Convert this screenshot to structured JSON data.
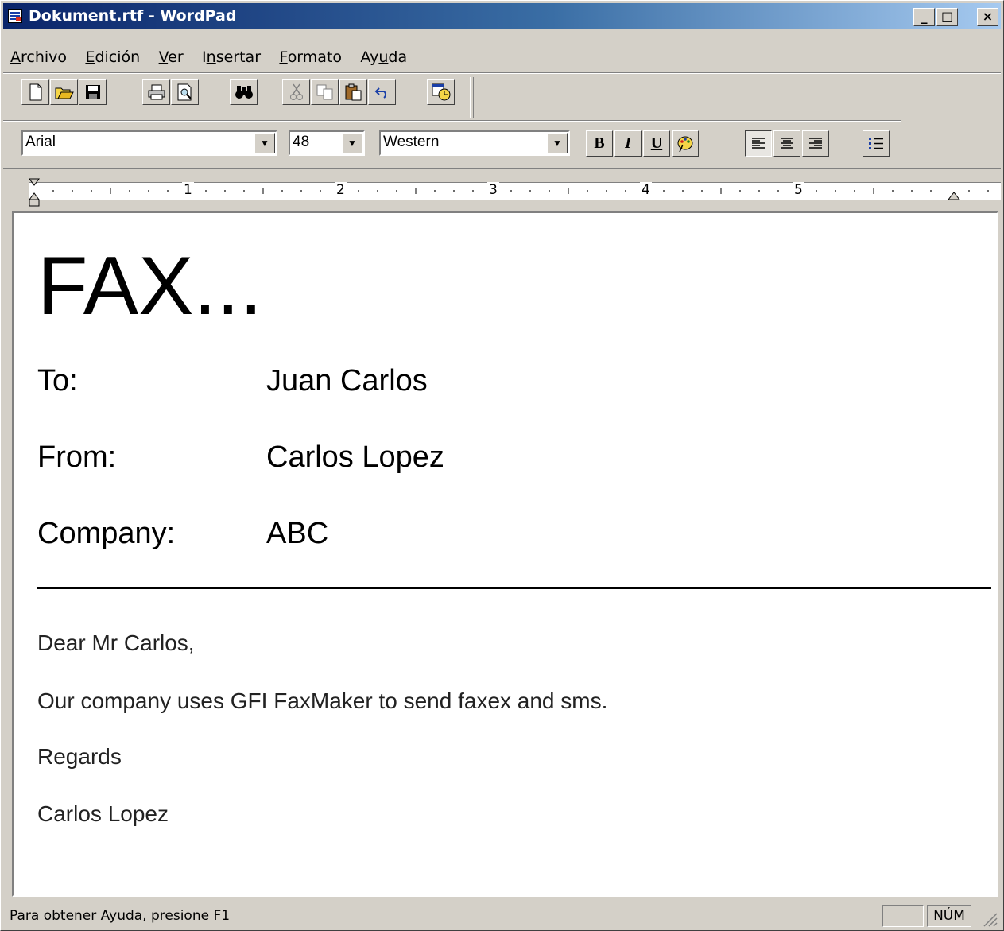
{
  "window": {
    "title": "Dokument.rtf - WordPad"
  },
  "caption_buttons": {
    "minimize": "_",
    "maximize": "□",
    "close": "×"
  },
  "menu": [
    {
      "pre": "",
      "key": "A",
      "post": "rchivo"
    },
    {
      "pre": "",
      "key": "E",
      "post": "dición"
    },
    {
      "pre": "",
      "key": "V",
      "post": "er"
    },
    {
      "pre": "I",
      "key": "n",
      "post": "sertar"
    },
    {
      "pre": "",
      "key": "F",
      "post": "ormato"
    },
    {
      "pre": "Ay",
      "key": "u",
      "post": "da"
    }
  ],
  "toolbar": {
    "icons": [
      "new-icon",
      "open-icon",
      "save-icon",
      "print-icon",
      "print-preview-icon",
      "find-icon",
      "cut-icon",
      "copy-icon",
      "paste-icon",
      "undo-icon",
      "date-time-icon"
    ]
  },
  "format": {
    "font": "Arial",
    "size": "48",
    "script": "Western",
    "bold": "B",
    "italic": "I",
    "underline": "U"
  },
  "ruler": {
    "marks": [
      "1",
      "2",
      "3",
      "4",
      "5"
    ]
  },
  "document": {
    "title": "FAX...",
    "fields": [
      {
        "label": "To:",
        "value": "Juan Carlos"
      },
      {
        "label": "From:",
        "value": "Carlos Lopez"
      },
      {
        "label": "Company:",
        "value": "ABC"
      }
    ],
    "body": [
      "Dear Mr Carlos,",
      "Our company uses GFI FaxMaker to send faxex and sms.",
      "Regards",
      "Carlos Lopez"
    ]
  },
  "status": {
    "help": "Para obtener Ayuda, presione F1",
    "num": "NÚM"
  }
}
